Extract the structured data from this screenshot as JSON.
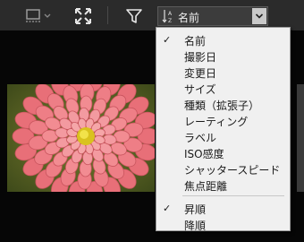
{
  "toolbar": {
    "grid_icon": "grid-view-icon",
    "fit_icon": "fit-to-screen-icon",
    "filter_icon": "filter-funnel-icon",
    "sort_icon": "sort-az-icon",
    "sort_value": "名前"
  },
  "sort_menu": {
    "fields": [
      {
        "label": "名前",
        "checked": true
      },
      {
        "label": "撮影日",
        "checked": false
      },
      {
        "label": "変更日",
        "checked": false
      },
      {
        "label": "サイズ",
        "checked": false
      },
      {
        "label": "種類（拡張子）",
        "checked": false
      },
      {
        "label": "レーティング",
        "checked": false
      },
      {
        "label": "ラベル",
        "checked": false
      },
      {
        "label": "ISO感度",
        "checked": false
      },
      {
        "label": "シャッタースピード",
        "checked": false
      },
      {
        "label": "焦点距離",
        "checked": false
      }
    ],
    "order": [
      {
        "label": "昇順",
        "checked": true
      },
      {
        "label": "降順",
        "checked": false
      }
    ],
    "check_mark": "✓"
  },
  "colors": {
    "toolbar_bg": "#2b2b2b",
    "menu_bg": "#f0f0f0",
    "photo_petal": "#f07a80"
  }
}
